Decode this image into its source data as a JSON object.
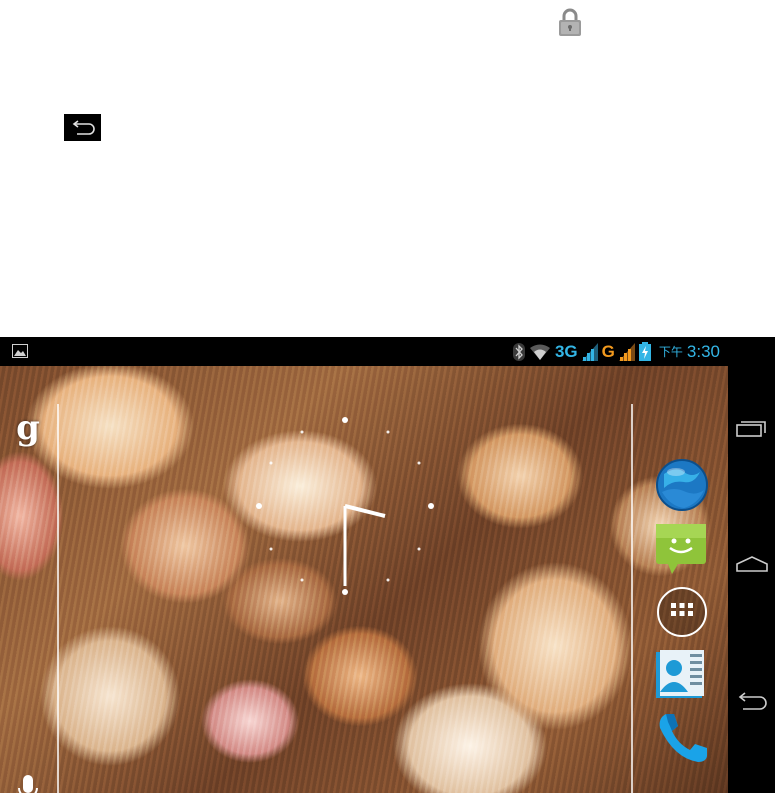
{
  "status_bar": {
    "network_1": "3G",
    "network_2": "G",
    "ampm": "下午",
    "time": "3:30",
    "icons": [
      "gallery-icon",
      "bluetooth-icon",
      "wifi-icon",
      "signal-icon",
      "battery-charging-icon"
    ]
  },
  "home_screen": {
    "search_widget": {
      "google_label": "g",
      "icon": "google-search-icon",
      "voice_icon": "microphone-icon"
    },
    "clock": {
      "icon": "analog-clock-icon"
    },
    "dock": {
      "apps": [
        "browser-icon",
        "messaging-icon",
        "app-drawer-icon",
        "contacts-icon",
        "phone-icon"
      ]
    }
  },
  "nav_bar": {
    "icons": [
      "recent-apps-icon",
      "home-icon",
      "back-icon"
    ]
  },
  "overlay": {
    "icons": [
      "lock-icon",
      "back-icon"
    ]
  },
  "colors": {
    "status_accent": "#33b5e5",
    "network_2g": "#f39a1e",
    "nav_bar_bg": "#000000",
    "nav_icon": "#cccccc"
  }
}
